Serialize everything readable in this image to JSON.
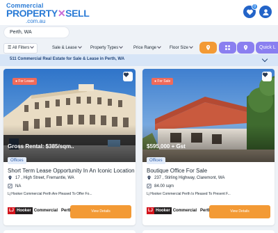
{
  "brand": {
    "line1": "Commercial",
    "line2_a": "PROPERTY",
    "line2_b": "SELL",
    "line3": ".com.au"
  },
  "header": {
    "favourites_count": "0",
    "favourites_icon": "heart-icon",
    "account_icon": "user-icon"
  },
  "search": {
    "value": "Perth, WA"
  },
  "filters": {
    "items": [
      "All Filters",
      "Sale & Lease",
      "Property Types",
      "Price Range",
      "Floor Size"
    ],
    "view_buttons": [
      {
        "icon": "location-pin-icon",
        "color": "#f39a35"
      },
      {
        "icon": "grid-icon",
        "color": "#8a7ff0"
      },
      {
        "icon": "map-marker-icon",
        "color": "#8a7ff0"
      }
    ],
    "quick_label": "Quick L"
  },
  "results": {
    "text": "511 Commercial Real Estate for Sale & Lease in Perth, WA"
  },
  "listings": [
    {
      "tag": "For Lease",
      "price": "Gross Rental: $385/sqm..",
      "category": "Offices",
      "title": "Short Term Lease Opportunity In An Iconic Location",
      "address": "17 , High Street, Fremantle, WA",
      "size": "NA",
      "description": "Lj Hooker Commercial Perth Are Pleased To Offer Fo...",
      "agency_a": "LJ",
      "agency_b": "Hooker",
      "agency_c": "Commercial",
      "agency_location": "Perth",
      "cta": "View Details"
    },
    {
      "tag": "For Sale",
      "price": "$595,000 + Gst",
      "category": "Offices",
      "title": "Boutique Office For Sale",
      "address": "237 , Stirling Highway, Claremont, WA",
      "size": "84.00 sqm",
      "description": "Lj Hooker Commercial Perth Is Pleased To Present F...",
      "agency_a": "LJ",
      "agency_b": "Hooker",
      "agency_c": "Commercial",
      "agency_location": "Perth",
      "cta": "View Details"
    }
  ],
  "colors": {
    "primary": "#2364c8",
    "accent_orange": "#f39a35",
    "accent_purple": "#8a7ff0",
    "tag_red": "#f06a5a"
  }
}
